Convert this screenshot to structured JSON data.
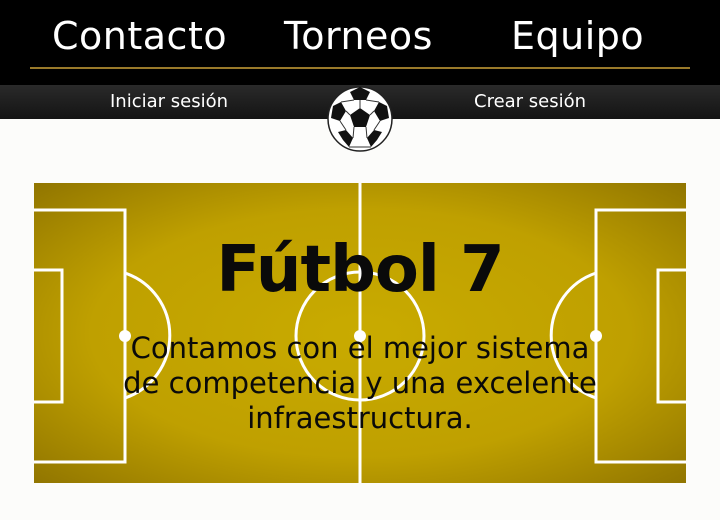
{
  "nav": {
    "items": [
      {
        "label": "Contacto"
      },
      {
        "label": "Torneos"
      },
      {
        "label": "Equipo"
      }
    ]
  },
  "auth": {
    "login_label": "Iniciar sesión",
    "signup_label": "Crear sesión"
  },
  "logo": {
    "icon": "soccer-ball-icon"
  },
  "hero": {
    "title": "Fútbol 7",
    "subtitle_lines": [
      "Contamos con el mejor sistema",
      "de competencia y una excelente",
      "infraestructura."
    ]
  },
  "colors": {
    "nav_bg": "#000000",
    "accent_line": "#9a7a2a",
    "field_gold": "#c2a300",
    "field_dark": "#8a6f00"
  }
}
